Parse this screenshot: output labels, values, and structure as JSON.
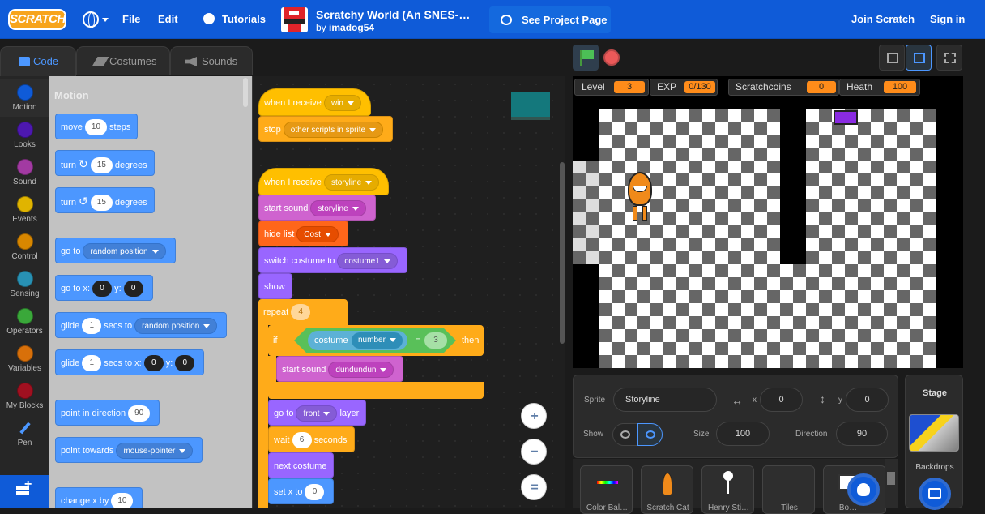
{
  "topbar": {
    "logo": "SCRATCH",
    "file": "File",
    "edit": "Edit",
    "tutorials": "Tutorials",
    "project_title": "Scratchy World (An SNES-…",
    "by_label": "by",
    "author": "imadog54",
    "see_project": "See Project Page",
    "join": "Join Scratch",
    "signin": "Sign in"
  },
  "tabs": [
    {
      "label": "Code",
      "icon": "code-icon"
    },
    {
      "label": "Costumes",
      "icon": "brush-icon"
    },
    {
      "label": "Sounds",
      "icon": "speaker-icon"
    }
  ],
  "categories": [
    {
      "label": "Motion",
      "color": "#4c97ff"
    },
    {
      "label": "Looks",
      "color": "#9966ff"
    },
    {
      "label": "Sound",
      "color": "#cf63cf"
    },
    {
      "label": "Events",
      "color": "#ffbf00"
    },
    {
      "label": "Control",
      "color": "#ffab19"
    },
    {
      "label": "Sensing",
      "color": "#5cb1d6"
    },
    {
      "label": "Operators",
      "color": "#59c059"
    },
    {
      "label": "Variables",
      "color": "#ff8c1a"
    },
    {
      "label": "My Blocks",
      "color": "#ff6680"
    },
    {
      "label": "Pen",
      "color": "#0fbd8c"
    }
  ],
  "palette": {
    "heading": "Motion",
    "move": {
      "a": "move",
      "n": "10",
      "b": "steps"
    },
    "turn_cw": {
      "a": "turn",
      "n": "15",
      "b": "degrees"
    },
    "turn_ccw": {
      "a": "turn",
      "n": "15",
      "b": "degrees"
    },
    "goto": {
      "a": "go to",
      "opt": "random position"
    },
    "gotoxy": {
      "a": "go to x:",
      "x": "0",
      "b": "y:",
      "y": "0"
    },
    "glide": {
      "a": "glide",
      "n": "1",
      "b": "secs to",
      "opt": "random position"
    },
    "glidexy": {
      "a": "glide",
      "n": "1",
      "b": "secs to x:",
      "x": "0",
      "c": "y:",
      "y": "0"
    },
    "point_dir": {
      "a": "point in direction",
      "n": "90"
    },
    "point_towards": {
      "a": "point towards",
      "opt": "mouse-pointer"
    },
    "change_x": {
      "a": "change x by",
      "n": "10"
    }
  },
  "scripts": {
    "s1_hat": {
      "a": "when I receive",
      "opt": "win"
    },
    "s1_stop": {
      "a": "stop",
      "opt": "other scripts in sprite"
    },
    "s2_hat": {
      "a": "when I receive",
      "opt": "storyline"
    },
    "start_sound": {
      "a": "start sound",
      "opt": "storyline"
    },
    "hide_list": {
      "a": "hide list",
      "opt": "Cost"
    },
    "switch_costume": {
      "a": "switch costume to",
      "opt": "costume1"
    },
    "show": "show",
    "repeat": {
      "a": "repeat",
      "n": "4"
    },
    "if": {
      "a": "if",
      "b": "costume",
      "opt": "number",
      "eq": "=",
      "n": "3",
      "then": "then"
    },
    "start_sound2": {
      "a": "start sound",
      "opt": "dundundun"
    },
    "goto_layer": {
      "a": "go to",
      "opt": "front",
      "b": "layer"
    },
    "wait": {
      "a": "wait",
      "n": "6",
      "b": "seconds"
    },
    "next_costume": "next costume",
    "setx": {
      "a": "set x to",
      "n": "0"
    }
  },
  "zoom": {
    "in": "+",
    "out": "−",
    "reset": "="
  },
  "monitors": {
    "level": {
      "label": "Level",
      "value": "3"
    },
    "exp": {
      "label": "EXP",
      "value": "0/130"
    },
    "coins": {
      "label": "Scratchcoins",
      "value": "0"
    },
    "health": {
      "label": "Heath",
      "value": "100"
    }
  },
  "sprite_info": {
    "sprite_label": "Sprite",
    "sprite_name": "Storyline",
    "x_label": "x",
    "x": "0",
    "y_label": "y",
    "y": "0",
    "show_label": "Show",
    "size_label": "Size",
    "size": "100",
    "direction_label": "Direction",
    "direction": "90"
  },
  "sprites": [
    {
      "name": "Color Bal…"
    },
    {
      "name": "Scratch Cat"
    },
    {
      "name": "Henry Sti…"
    },
    {
      "name": "Tiles"
    },
    {
      "name": "Bo…"
    }
  ],
  "stage_pane": {
    "title": "Stage",
    "backdrops": "Backdrops"
  },
  "colors": {
    "accent": "#0f5bd8",
    "monitor": "#ff8c1a"
  }
}
